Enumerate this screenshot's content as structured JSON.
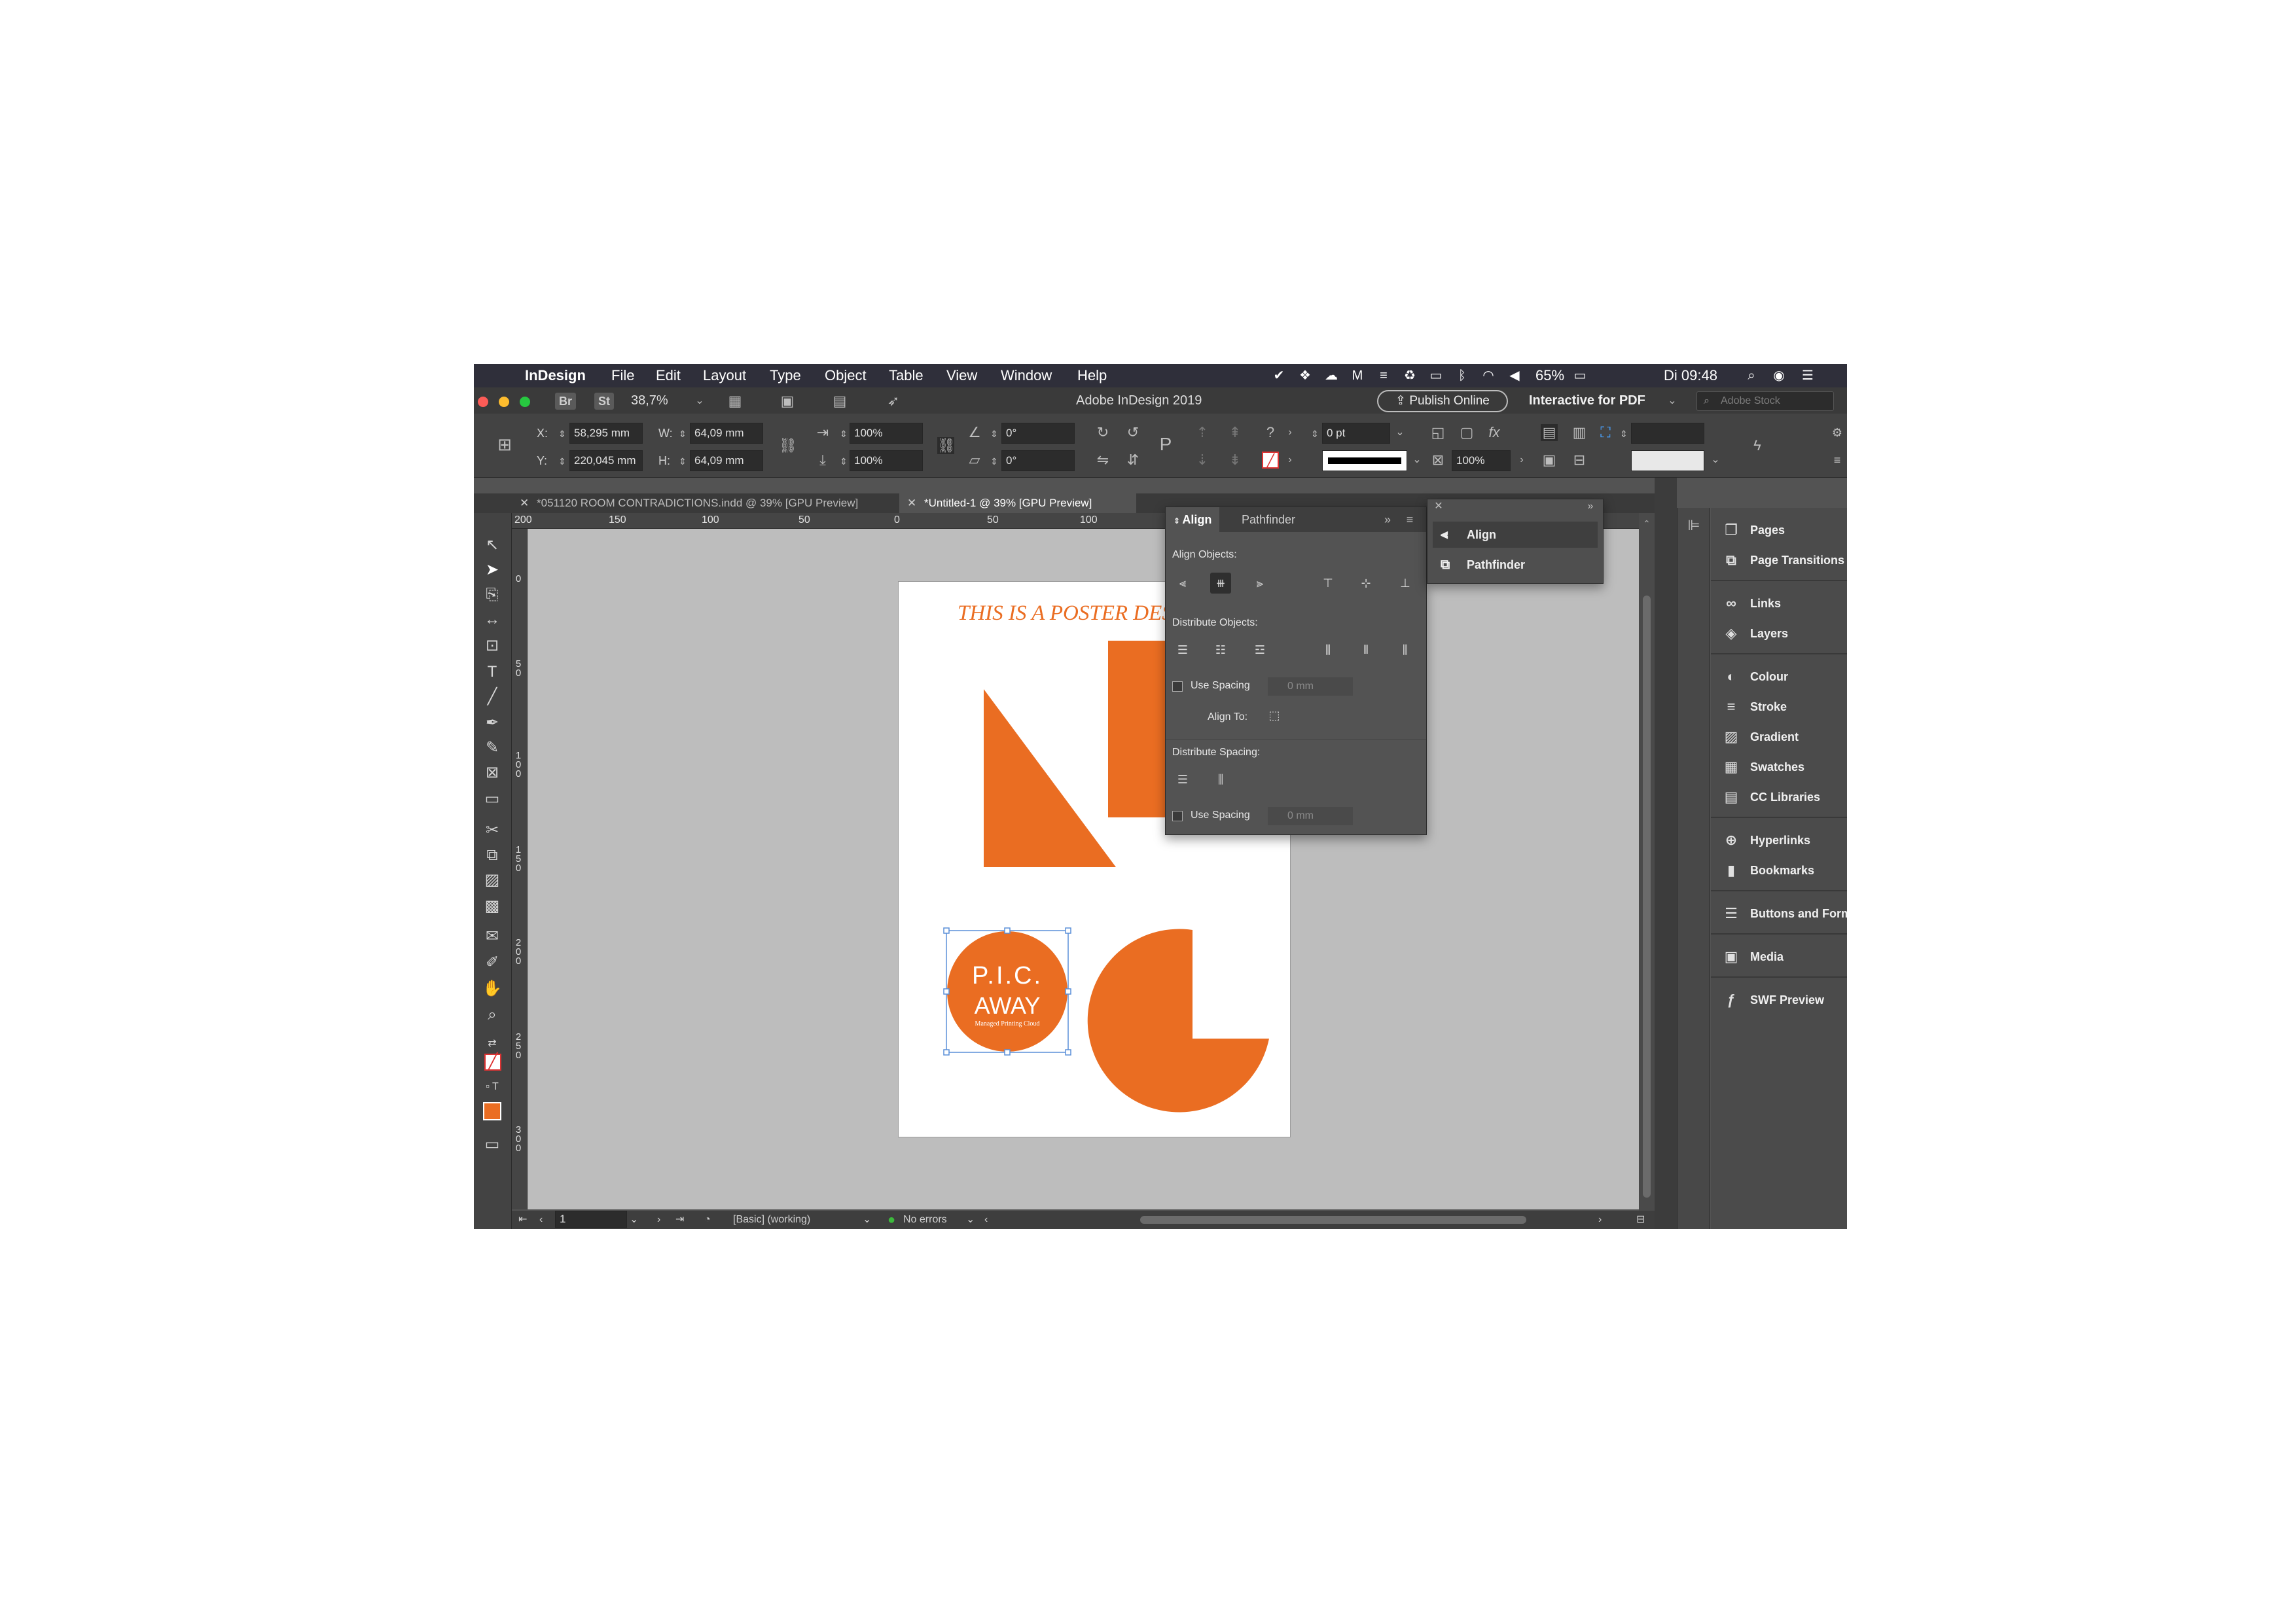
{
  "menubar": {
    "apple": "",
    "app_name": "InDesign",
    "items": [
      "File",
      "Edit",
      "Layout",
      "Type",
      "Object",
      "Table",
      "View",
      "Window",
      "Help"
    ],
    "battery": "65%",
    "clock": "Di 09:48"
  },
  "appbar": {
    "bridge": "Br",
    "stock": "St",
    "zoom": "38,7%",
    "window_title": "Adobe InDesign 2019",
    "publish_online": "Publish Online",
    "workspace": "Interactive for PDF",
    "search_placeholder": "Adobe Stock"
  },
  "controlbar": {
    "x_label": "X:",
    "x_value": "58,295 mm",
    "y_label": "Y:",
    "y_value": "220,045 mm",
    "w_label": "W:",
    "w_value": "64,09 mm",
    "h_label": "H:",
    "h_value": "64,09 mm",
    "scale_x": "100%",
    "scale_y": "100%",
    "rotation": "0°",
    "shear": "0°",
    "stroke_weight": "0 pt",
    "opacity": "100%"
  },
  "tabs": [
    {
      "label": "*051120 ROOM CONTRADICTIONS.indd @ 39% [GPU Preview]",
      "active": false
    },
    {
      "label": "*Untitled-1 @ 39% [GPU Preview]",
      "active": true
    }
  ],
  "hruler": [
    "200",
    "150",
    "100",
    "50",
    "0",
    "50",
    "100"
  ],
  "vruler": [
    "0",
    "50",
    "100",
    "150",
    "200",
    "250",
    "300"
  ],
  "page": {
    "title": "THIS IS A POSTER DESIGN",
    "logo_line1": "P.I.C.",
    "logo_line2": "AWAY",
    "logo_tagline": "Managed Printing Cloud",
    "accent": "#ea6d22"
  },
  "statusbar": {
    "page_number": "1",
    "preflight_profile": "[Basic] (working)",
    "errors": "No errors"
  },
  "align_panel": {
    "tab_align": "Align",
    "tab_pathfinder": "Pathfinder",
    "align_objects": "Align Objects:",
    "distribute_objects": "Distribute Objects:",
    "use_spacing_1": "Use Spacing",
    "spacing_value_1": "0 mm",
    "align_to": "Align To:",
    "distribute_spacing": "Distribute Spacing:",
    "use_spacing_2": "Use Spacing",
    "spacing_value_2": "0 mm"
  },
  "flyout": {
    "items": [
      "Align",
      "Pathfinder"
    ]
  },
  "dock": {
    "items": [
      "Pages",
      "Page Transitions",
      "Links",
      "Layers",
      "Colour",
      "Stroke",
      "Gradient",
      "Swatches",
      "CC Libraries",
      "Hyperlinks",
      "Bookmarks",
      "Buttons and Forms",
      "Media",
      "SWF Preview"
    ]
  }
}
